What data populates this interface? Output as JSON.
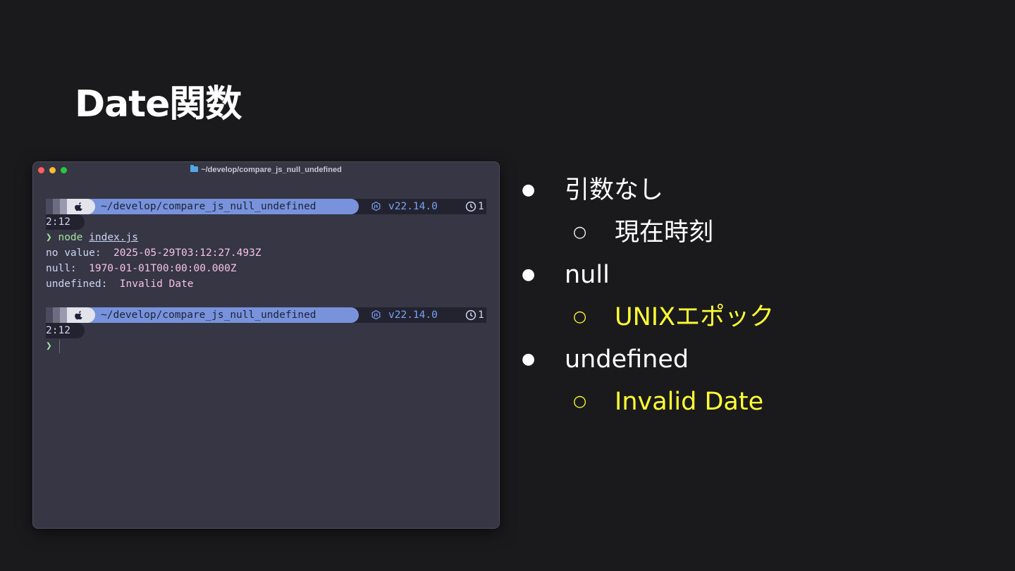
{
  "slide": {
    "title": "Date関数"
  },
  "terminal": {
    "window_title": "~/develop/compare_js_null_undefined",
    "prompt": {
      "path": "~/develop/compare_js_null_undefined",
      "node_version": "v22.14.0",
      "time_first": "1",
      "time_wrap": "2:12"
    },
    "command_symbol": "❯",
    "command": "node",
    "command_arg": "index.js",
    "output": [
      {
        "label": "no value:  ",
        "value": "2025-05-29T03:12:27.493Z"
      },
      {
        "label": "null:  ",
        "value": "1970-01-01T00:00:00.000Z"
      },
      {
        "label": "undefined:  ",
        "value": "Invalid Date"
      }
    ],
    "icons": {
      "apple": "apple-icon",
      "node": "nodejs-icon",
      "clock": "clock-icon",
      "folder": "folder-icon"
    },
    "colors": {
      "background": "#363645",
      "path_segment": "#7893dc",
      "output_values": "#f5c2e7",
      "prompt_symbol": "#a6e3a1"
    }
  },
  "bullets": {
    "bullet_glyph": "●",
    "sub_glyph": "○",
    "items": [
      {
        "text": "引数なし",
        "sub": "現在時刻"
      },
      {
        "text": "null",
        "sub": "UNIXエポック"
      },
      {
        "text": "undefined",
        "sub": "Invalid Date"
      }
    ],
    "highlight_color": "#ffff33"
  }
}
